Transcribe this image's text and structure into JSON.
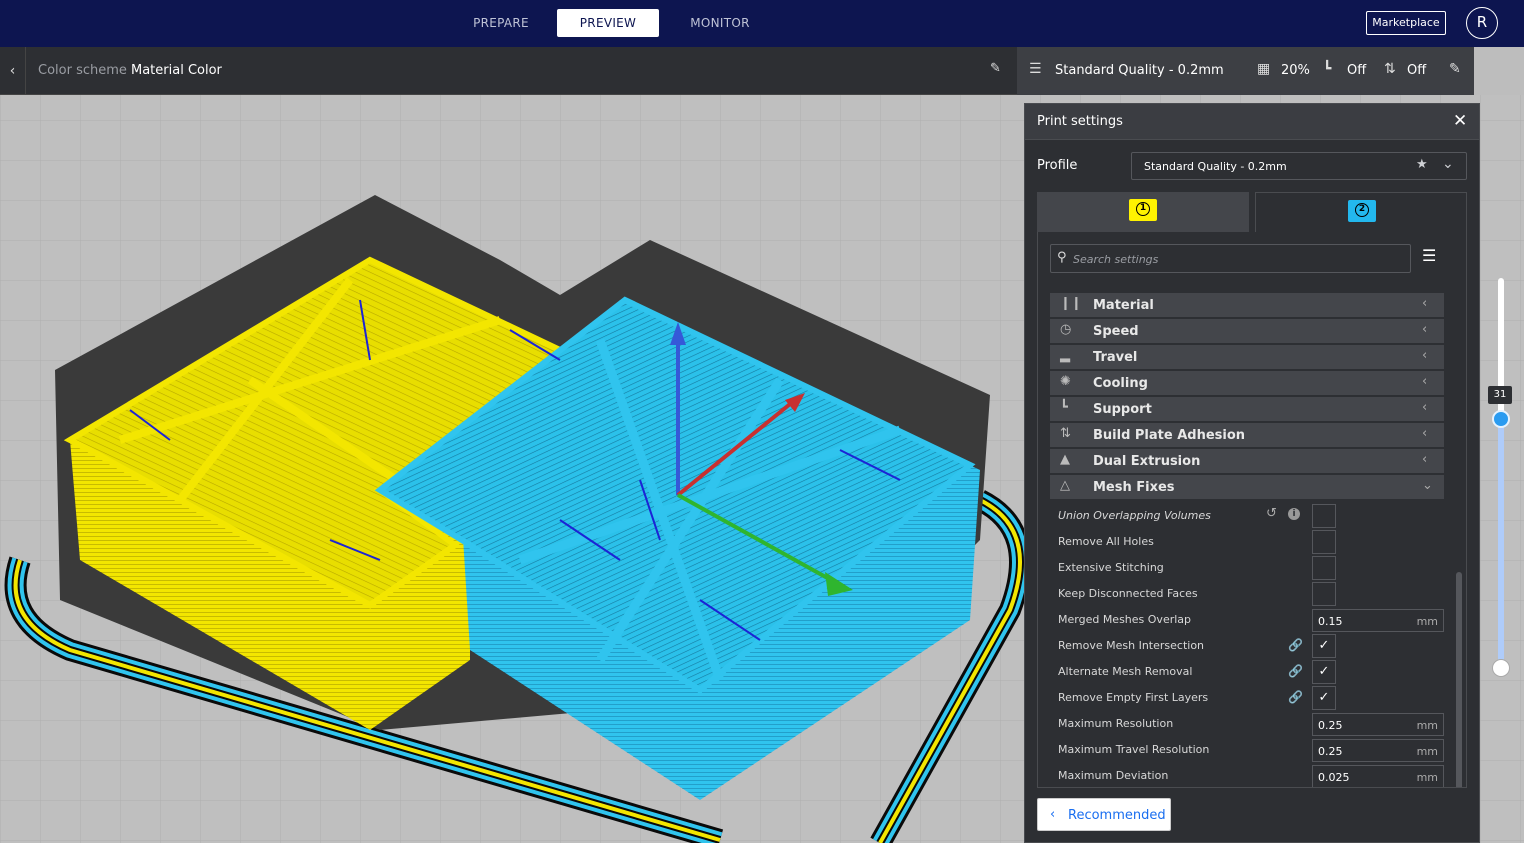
{
  "topbar": {
    "tabs": [
      {
        "label": "PREPARE",
        "active": false
      },
      {
        "label": "PREVIEW",
        "active": true
      },
      {
        "label": "MONITOR",
        "active": false
      }
    ],
    "marketplace_label": "Marketplace",
    "avatar_initial": "R"
  },
  "color_scheme": {
    "label": "Color scheme",
    "value": "Material Color"
  },
  "quality_bar": {
    "profile": "Standard Quality - 0.2mm",
    "infill": "20%",
    "support": "Off",
    "adhesion": "Off"
  },
  "print_settings": {
    "title": "Print settings",
    "profile_label": "Profile",
    "profile_value": "Standard Quality - 0.2mm",
    "extruders": [
      {
        "number": "1",
        "color": "#fff200"
      },
      {
        "number": "2",
        "color": "#23b8ee"
      }
    ],
    "search_placeholder": "Search settings",
    "categories": [
      {
        "label": "Material",
        "icon": "material-icon"
      },
      {
        "label": "Speed",
        "icon": "speed-icon"
      },
      {
        "label": "Travel",
        "icon": "travel-icon"
      },
      {
        "label": "Cooling",
        "icon": "fan-icon"
      },
      {
        "label": "Support",
        "icon": "support-icon"
      },
      {
        "label": "Build Plate Adhesion",
        "icon": "adhesion-icon"
      },
      {
        "label": "Dual Extrusion",
        "icon": "dual-extrusion-icon"
      },
      {
        "label": "Mesh Fixes",
        "icon": "mesh-fixes-icon",
        "expanded": true
      }
    ],
    "settings": [
      {
        "label": "Union Overlapping Volumes",
        "type": "checkbox",
        "checked": false,
        "reset": true,
        "info": true
      },
      {
        "label": "Remove All Holes",
        "type": "checkbox",
        "checked": false
      },
      {
        "label": "Extensive Stitching",
        "type": "checkbox",
        "checked": false
      },
      {
        "label": "Keep Disconnected Faces",
        "type": "checkbox",
        "checked": false
      },
      {
        "label": "Merged Meshes Overlap",
        "type": "number",
        "value": "0.15",
        "unit": "mm"
      },
      {
        "label": "Remove Mesh Intersection",
        "type": "checkbox",
        "checked": true,
        "link": true
      },
      {
        "label": "Alternate Mesh Removal",
        "type": "checkbox",
        "checked": true,
        "link": true
      },
      {
        "label": "Remove Empty First Layers",
        "type": "checkbox",
        "checked": true,
        "link": true
      },
      {
        "label": "Maximum Resolution",
        "type": "number",
        "value": "0.25",
        "unit": "mm"
      },
      {
        "label": "Maximum Travel Resolution",
        "type": "number",
        "value": "0.25",
        "unit": "mm"
      },
      {
        "label": "Maximum Deviation",
        "type": "number",
        "value": "0.025",
        "unit": "mm"
      }
    ],
    "recommended_label": "Recommended"
  },
  "layer_slider": {
    "current_layer": "31"
  },
  "colors": {
    "brand_navy": "#0d1550",
    "accent_blue": "#196ef0",
    "extruder_yellow": "#fff200",
    "extruder_cyan": "#23b8ee"
  }
}
